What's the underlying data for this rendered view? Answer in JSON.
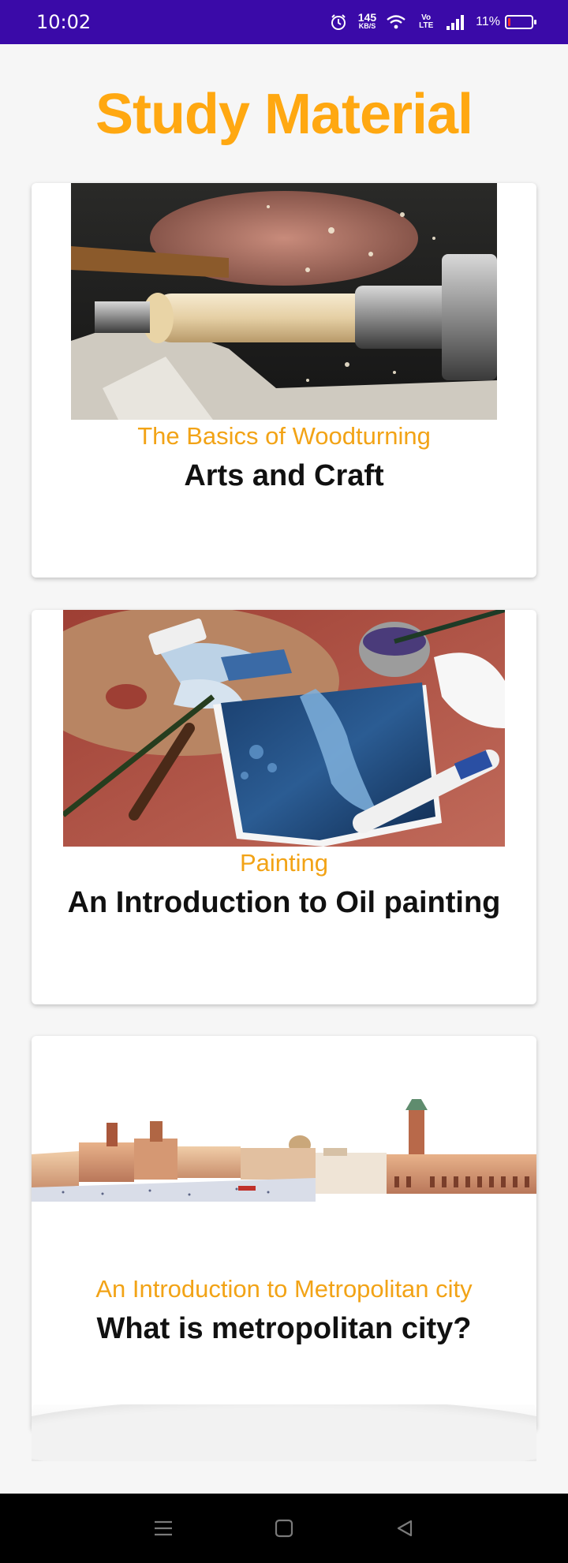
{
  "status_bar": {
    "time": "10:02",
    "net_speed_value": "145",
    "net_speed_unit": "KB/S",
    "volte": "Vo LTE",
    "battery_percent": "11%",
    "battery_level": 0.11,
    "icons": [
      "alarm-icon",
      "wifi-icon",
      "volte-icon",
      "signal-icon",
      "battery-icon"
    ]
  },
  "page": {
    "title": "Study Material",
    "accent_color": "#ffa811",
    "header_color": "#3a0aa8"
  },
  "cards": [
    {
      "image": "woodturning-lathe-photo",
      "subtitle": "The Basics of Woodturning",
      "title": "Arts and Craft"
    },
    {
      "image": "oil-painting-palette-photo",
      "subtitle": "Painting",
      "title": "An Introduction to Oil painting"
    },
    {
      "image": "metropolitan-city-panorama",
      "subtitle": "An Introduction to Metropolitan city",
      "title": "What is metropolitan city?"
    }
  ],
  "nav_bar": {
    "icons": [
      "menu-icon",
      "home-square-icon",
      "back-triangle-icon"
    ]
  }
}
